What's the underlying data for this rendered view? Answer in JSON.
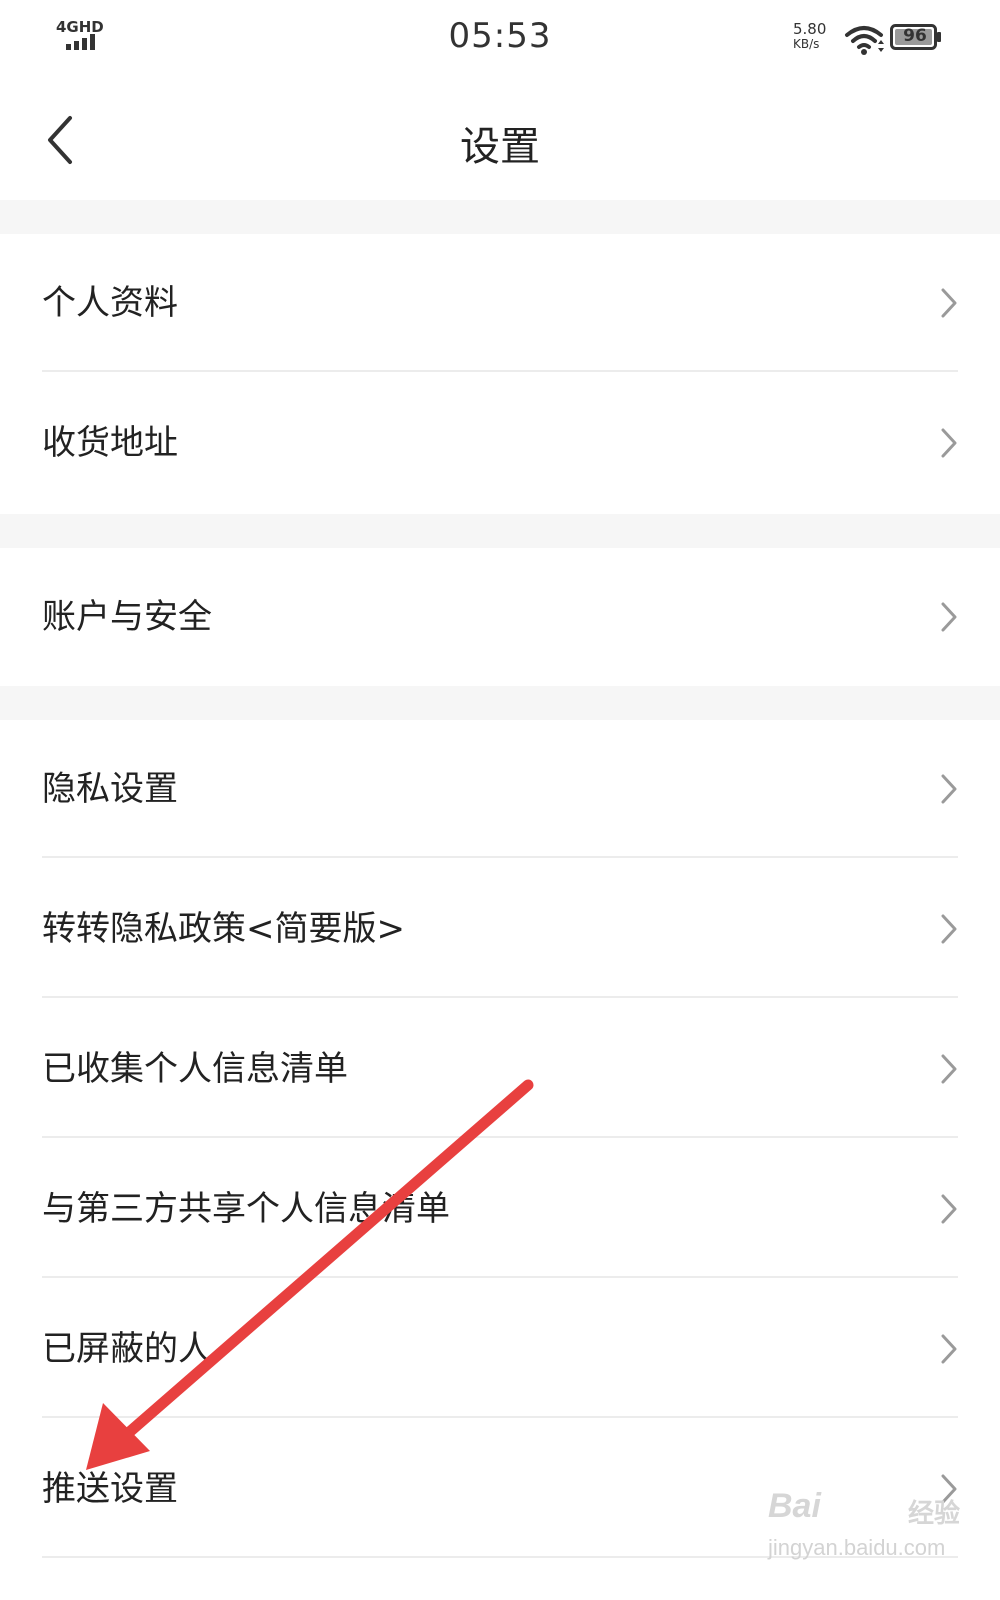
{
  "status_bar": {
    "network": "4GHD",
    "time": "05:53",
    "speed_value": "5.80",
    "speed_unit": "KB/s",
    "battery": "96",
    "icons": [
      "signal-icon",
      "wifi-icon",
      "battery-icon"
    ]
  },
  "header": {
    "title": "设置",
    "back_icon": "chevron-left-icon"
  },
  "settings": [
    {
      "label": "个人资料"
    },
    {
      "label": "收货地址"
    },
    {
      "label": "账户与安全"
    },
    {
      "label": "隐私设置"
    },
    {
      "label": "转转隐私政策<简要版>"
    },
    {
      "label": "已收集个人信息清单"
    },
    {
      "label": "与第三方共享个人信息清单"
    },
    {
      "label": "已屏蔽的人"
    },
    {
      "label": "推送设置"
    }
  ],
  "row_icon": "chevron-right-icon",
  "annotation": {
    "type": "arrow",
    "color": "#e8403f"
  },
  "watermark": {
    "brand": "Bai",
    "brand_suffix": "经验",
    "url": "jingyan.baidu.com"
  },
  "colors": {
    "background": "#ffffff",
    "group_gap": "#f6f6f6",
    "divider": "#ececec",
    "text": "#222222",
    "chevron": "#9a9a9a"
  }
}
